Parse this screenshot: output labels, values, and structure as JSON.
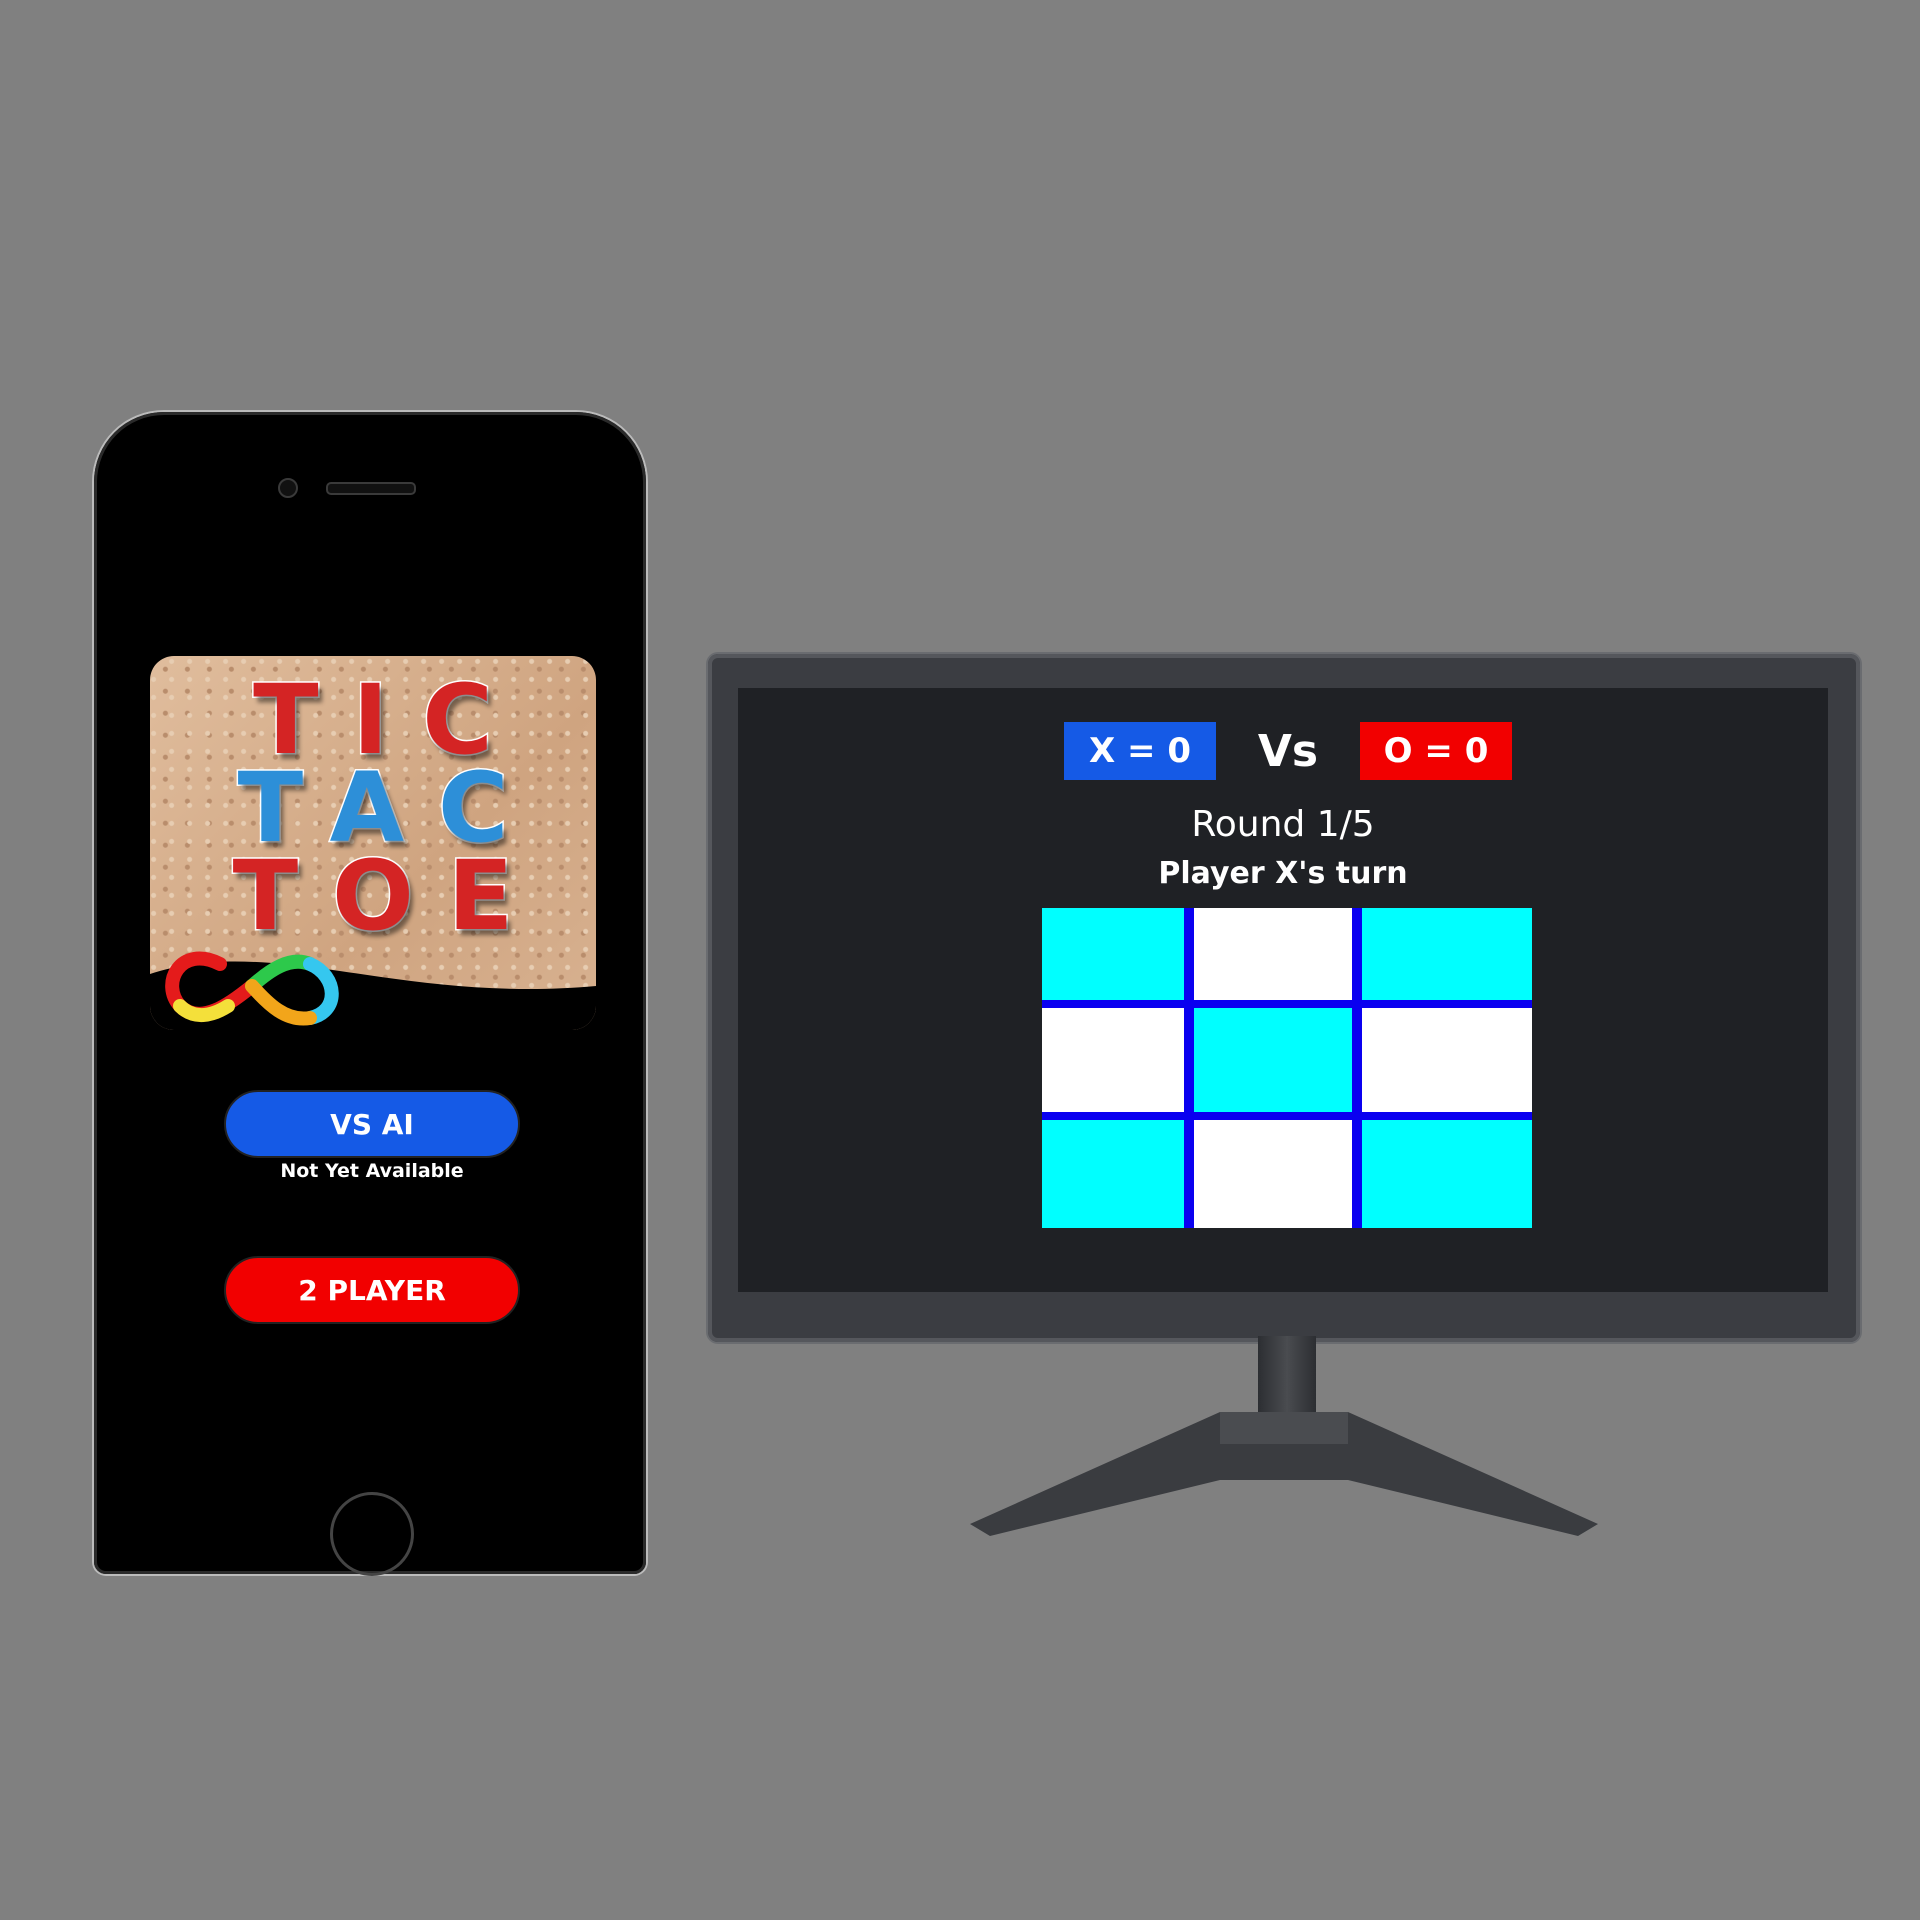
{
  "phone": {
    "logo_lines": [
      "TIC",
      "TAC",
      "TOE"
    ],
    "vs_ai_label": "VS AI",
    "vs_ai_note": "Not Yet Available",
    "two_player_label": "2 PLAYER"
  },
  "monitor": {
    "score_x": "X = 0",
    "vs_label": "Vs",
    "score_o": "O = 0",
    "round": "Round 1/5",
    "turn": "Player X's turn",
    "board": [
      "",
      "",
      "",
      "",
      "",
      "",
      "",
      "",
      ""
    ]
  },
  "colors": {
    "background": "#808080",
    "player_x": "#155ae6",
    "player_o": "#f20000",
    "board_lines": "#0a00f0",
    "cell_cyan": "#00ffff",
    "cell_white": "#ffffff",
    "screen": "#1f2125"
  }
}
